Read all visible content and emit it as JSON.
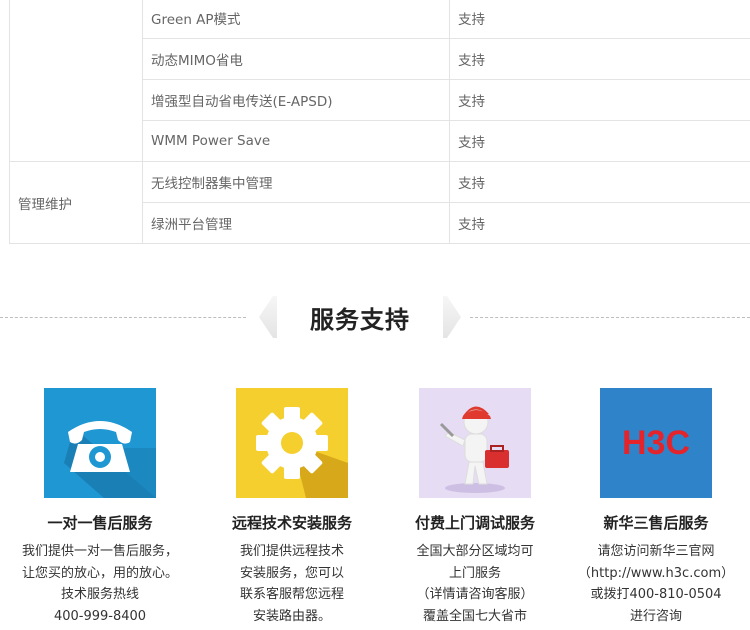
{
  "spec_table": {
    "rows": [
      {
        "category": "",
        "feature": "Green AP模式",
        "value": "支持"
      },
      {
        "category": "",
        "feature": "动态MIMO省电",
        "value": "支持"
      },
      {
        "category": "",
        "feature": "增强型自动省电传送(E-APSD)",
        "value": "支持"
      },
      {
        "category": "",
        "feature": "WMM Power Save",
        "value": "支持"
      },
      {
        "category": "管理维护",
        "feature": "无线控制器集中管理",
        "value": "支持"
      },
      {
        "category": "",
        "feature": "绿洲平台管理",
        "value": "支持"
      }
    ]
  },
  "section": {
    "title": "服务支持"
  },
  "services": [
    {
      "icon": "telephone-icon",
      "title": "一对一售后服务",
      "lines": [
        "我们提供一对一售后服务，",
        "让您买的放心，用的放心。",
        "技术服务热线",
        "400-999-8400"
      ]
    },
    {
      "icon": "gear-icon",
      "title": "远程技术安装服务",
      "lines": [
        "我们提供远程技术",
        "安装服务，您可以",
        "联系客服帮您远程",
        "安装路由器。"
      ]
    },
    {
      "icon": "technician-icon",
      "title": "付费上门调试服务",
      "lines": [
        "全国大部分区域均可",
        "上门服务",
        "（详情请咨询客服）",
        "覆盖全国七大省市"
      ]
    },
    {
      "icon": "h3c-logo",
      "logo_text": "H3C",
      "title": "新华三售后服务",
      "lines": [
        "请您访问新华三官网",
        "（http://www.h3c.com）",
        "或拨打400-810-0504",
        "进行咨询"
      ]
    }
  ],
  "colors": {
    "phone_tile": "#1f97d3",
    "gear_tile": "#f5cf2d",
    "worker_tile": "#e6dcf4",
    "logo_tile": "#2e83c9",
    "logo_red": "#e5232b"
  }
}
